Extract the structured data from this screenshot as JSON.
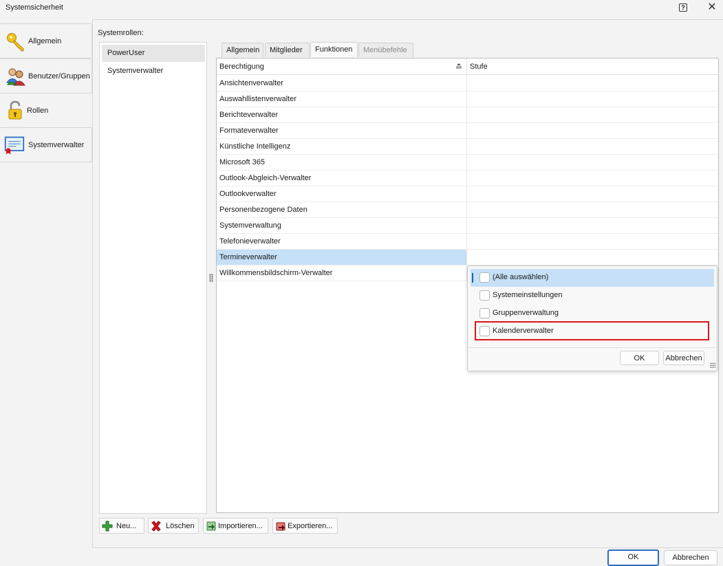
{
  "window": {
    "title": "Systemsicherheit",
    "help_icon": "help-icon",
    "close_icon": "close-icon"
  },
  "nav": {
    "items": [
      {
        "label": "Allgemein",
        "icon": "key-icon"
      },
      {
        "label": "Benutzer/Gruppen",
        "icon": "users-icon"
      },
      {
        "label": "Rollen",
        "icon": "padlock-icon"
      },
      {
        "label": "Systemverwalter",
        "icon": "certificate-icon"
      }
    ]
  },
  "roles": {
    "label": "Systemrollen:",
    "items": [
      "PowerUser",
      "Systemverwalter"
    ],
    "selected": "PowerUser"
  },
  "tabs": [
    {
      "label": "Allgemein",
      "state": "normal"
    },
    {
      "label": "Mitglieder",
      "state": "normal"
    },
    {
      "label": "Funktionen",
      "state": "active"
    },
    {
      "label": "Menübefehle",
      "state": "disabled"
    }
  ],
  "grid": {
    "columns": [
      "Berechtigung",
      "Stufe"
    ],
    "sort_icon": "sort-ascending-icon",
    "rows": [
      "Ansichtenverwalter",
      "Auswahllistenverwalter",
      "Berichteverwalter",
      "Formateverwalter",
      "Künstliche Intelligenz",
      "Microsoft 365",
      "Outlook-Abgleich-Verwalter",
      "Outlookverwalter",
      "Personenbezogene Daten",
      "Systemverwaltung",
      "Telefonieverwalter",
      "Termineverwalter",
      "Willkommensbildschirm-Verwalter"
    ],
    "selected_row": "Termineverwalter"
  },
  "dropdown": {
    "options": [
      {
        "label": "(Alle auswählen)",
        "checked": false
      },
      {
        "label": "Systemeinstellungen",
        "checked": false
      },
      {
        "label": "Gruppenverwaltung",
        "checked": false
      },
      {
        "label": "Kalenderverwalter",
        "checked": false
      }
    ],
    "highlighted": "(Alle auswählen)",
    "marked": "Kalenderverwalter",
    "ok_label": "OK",
    "cancel_label": "Abbrechen"
  },
  "toolbar": {
    "new_label": "Neu...",
    "delete_label": "Löschen",
    "import_label": "Importieren...",
    "export_label": "Exportieren..."
  },
  "footer": {
    "ok_label": "OK",
    "cancel_label": "Abbrechen"
  },
  "colors": {
    "selection": "#c5e0f7",
    "focus_border": "#2a6cc4",
    "annotation_red": "#d9141b"
  }
}
